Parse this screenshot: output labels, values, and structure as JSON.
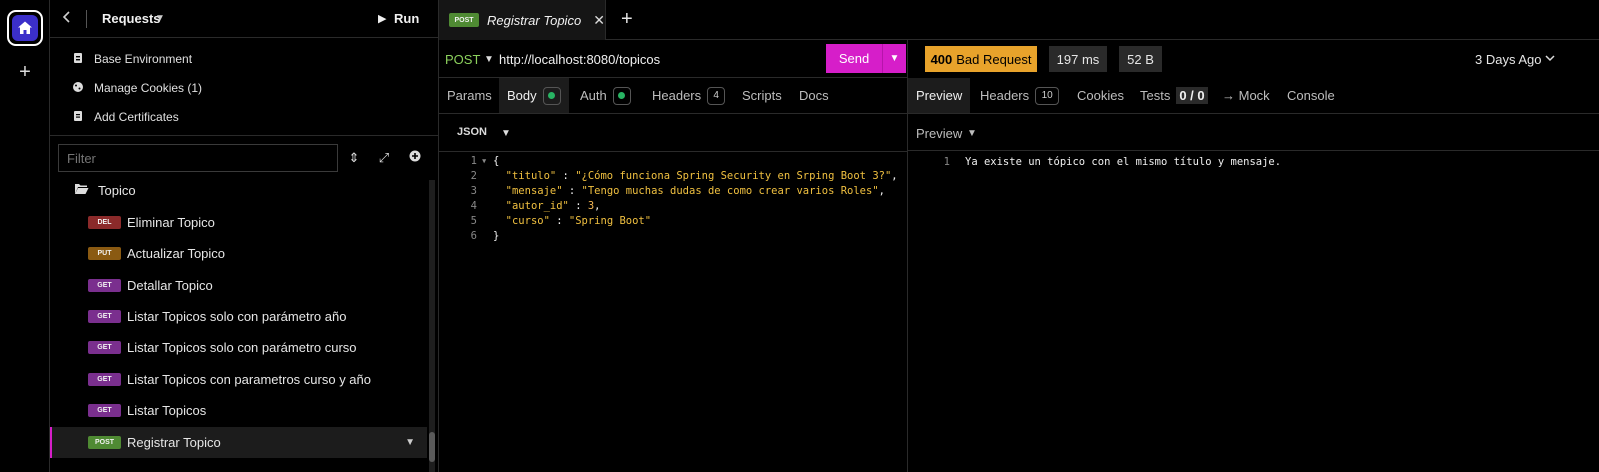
{
  "rail": {
    "add_label": "+"
  },
  "sidebar": {
    "title": "Requests",
    "run_label": "Run",
    "tools": [
      {
        "label": "Base Environment",
        "icon": "environment-icon"
      },
      {
        "label": "Manage Cookies (1)",
        "icon": "cookie-icon"
      },
      {
        "label": "Add Certificates",
        "icon": "certificate-icon"
      }
    ],
    "filter_placeholder": "Filter",
    "folder": "Topico",
    "requests": [
      {
        "method": "DEL",
        "label": "Eliminar Topico",
        "color": "#8b2a2a"
      },
      {
        "method": "PUT",
        "label": "Actualizar Topico",
        "color": "#8a5a12"
      },
      {
        "method": "GET",
        "label": "Detallar Topico",
        "color": "#7a2f8e"
      },
      {
        "method": "GET",
        "label": "Listar Topicos solo con parámetro año",
        "color": "#7a2f8e"
      },
      {
        "method": "GET",
        "label": "Listar Topicos solo con parámetro curso",
        "color": "#7a2f8e"
      },
      {
        "method": "GET",
        "label": "Listar Topicos con parametros curso y año",
        "color": "#7a2f8e"
      },
      {
        "method": "GET",
        "label": "Listar Topicos",
        "color": "#7a2f8e"
      },
      {
        "method": "POST",
        "label": "Registrar Topico",
        "color": "#4f8a33"
      }
    ]
  },
  "tab": {
    "method": "POST",
    "title": "Registrar Topico",
    "close": "✕",
    "add": "+"
  },
  "request": {
    "method": "POST",
    "url": "http://localhost:8080/topicos",
    "send_label": "Send",
    "tabs": {
      "params": "Params",
      "body": "Body",
      "auth": "Auth",
      "headers": "Headers",
      "headers_count": "4",
      "scripts": "Scripts",
      "docs": "Docs"
    },
    "body_type": "JSON",
    "body_lines": [
      {
        "n": "1",
        "text": "{"
      },
      {
        "n": "2",
        "key": "\"titulo\"",
        "val": "\"¿Cómo funciona Spring Security en Srping Boot 3?\"",
        "end": ","
      },
      {
        "n": "3",
        "key": "\"mensaje\"",
        "val": "\"Tengo muchas dudas de como crear varios Roles\"",
        "end": ","
      },
      {
        "n": "4",
        "key": "\"autor_id\"",
        "val": "3",
        "end": ","
      },
      {
        "n": "5",
        "key": "\"curso\"",
        "val": "\"Spring Boot\"",
        "end": ""
      },
      {
        "n": "6",
        "text": "}"
      }
    ]
  },
  "response": {
    "status_code": "400",
    "status_text": "Bad Request",
    "time": "197 ms",
    "size": "52 B",
    "ago": "3 Days Ago",
    "status_color": "#e8a32b",
    "tabs": {
      "preview": "Preview",
      "headers": "Headers",
      "headers_count": "10",
      "cookies": "Cookies",
      "tests": "Tests",
      "tests_count": "0 / 0",
      "mock": "→ Mock",
      "console": "Console"
    },
    "preview_mode": "Preview",
    "line_no": "1",
    "line_text": "Ya existe un tópico con el mismo título y mensaje."
  }
}
